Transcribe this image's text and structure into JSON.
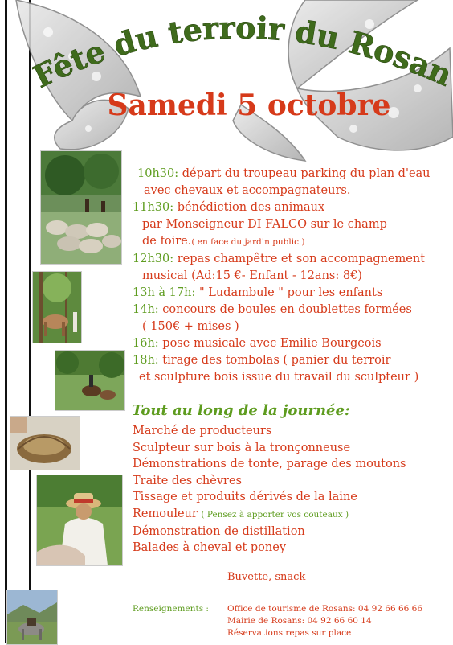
{
  "header": {
    "title": "Fête du terroir du Rosanais",
    "date": "Samedi 5 octobre"
  },
  "programme": [
    {
      "time": "10h30:",
      "lines": [
        "départ du troupeau parking du plan d'eau",
        "avec chevaux et accompagnateurs."
      ]
    },
    {
      "time": "11h30:",
      "lines": [
        "bénédiction des animaux",
        "par Monseigneur DI FALCO  sur le champ",
        "de foire."
      ],
      "note": "( en face du jardin public )"
    },
    {
      "time": "12h30:",
      "lines": [
        "repas champêtre et son accompagnement",
        "musical (Ad:15 €- Enfant - 12ans: 8€)"
      ]
    },
    {
      "time": "13h à 17h:",
      "lines": [
        "\" Ludambule \" pour les enfants"
      ]
    },
    {
      "time": "14h:",
      "lines": [
        "concours de boules en doublettes formées",
        "( 150€ + mises )"
      ]
    },
    {
      "time": "16h:",
      "lines": [
        "pose musicale avec Emilie Bourgeois"
      ]
    },
    {
      "time": "18h:",
      "lines": [
        "tirage des tombolas ( panier du terroir",
        "et sculpture bois  issue du travail du sculpteur )"
      ]
    }
  ],
  "all_day": {
    "heading": "Tout au long de la journée:",
    "items": [
      {
        "text": "Marché de producteurs"
      },
      {
        "text": "Sculpteur sur bois à la tronçonneuse"
      },
      {
        "text": "Démonstrations de tonte, parage des moutons"
      },
      {
        "text": "Traite des chèvres"
      },
      {
        "text": "Tissage et produits dérivés de la laine"
      },
      {
        "text": "Remouleur",
        "note": "( Pensez à apporter vos couteaux )"
      },
      {
        "text": "Démonstration de distillation"
      },
      {
        "text": "Balades à cheval et poney"
      }
    ]
  },
  "buvette": "Buvette, snack",
  "info": {
    "label": "Renseignements :",
    "lines": [
      "Office de tourisme de Rosans: 04 92 66 66 66",
      "Mairie de Rosans: 04 92 66 60 14",
      "Réservations repas sur place"
    ]
  },
  "colors": {
    "red": "#d63a1a",
    "green": "#5e9c1f",
    "title_green": "#3f6b1c"
  }
}
